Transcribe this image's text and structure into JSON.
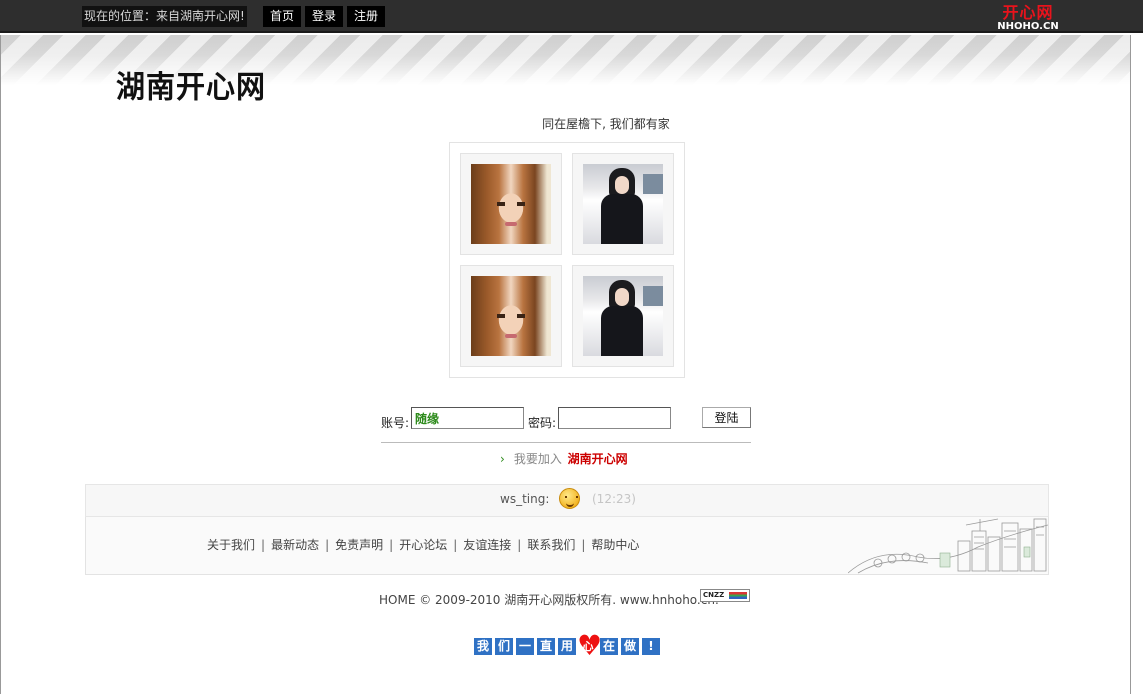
{
  "topbar": {
    "location": "现在的位置：来自湖南开心网!",
    "nav": [
      "首页",
      "登录",
      "注册"
    ],
    "brand_cn": "开心网",
    "brand_en": "NHOHO.CN"
  },
  "site": {
    "logo_text": "湖南开心网",
    "slogan": "同在屋檐下, 我们都有家"
  },
  "photos": [
    "brunette",
    "coat",
    "brunette",
    "coat"
  ],
  "login": {
    "account_label": "账号:",
    "account_value": "随缘",
    "password_label": "密码:",
    "password_value": "",
    "button": "登陆"
  },
  "join": {
    "arrow": "›",
    "text": "我要加入",
    "site_name": "湖南开心网"
  },
  "status": {
    "user": "ws_ting:",
    "time": "(12:23)"
  },
  "footer": {
    "links": [
      "关于我们",
      "最新动态",
      "免责声明",
      "开心论坛",
      "友谊连接",
      "联系我们",
      "帮助中心"
    ],
    "separator": "|",
    "copyright": "HOME © 2009-2010 湖南开心网版权所有. www.hnhoho.cn.",
    "counter_badge": "CNZZ"
  },
  "motto": [
    "我",
    "们",
    "一",
    "直",
    "用",
    "心",
    "在",
    "做",
    "!"
  ],
  "colors": {
    "accent_red": "#cc0000",
    "accent_green": "#2e8b1c",
    "motto_blue": "#2f71c4",
    "topbar": "#2e2e2e"
  }
}
